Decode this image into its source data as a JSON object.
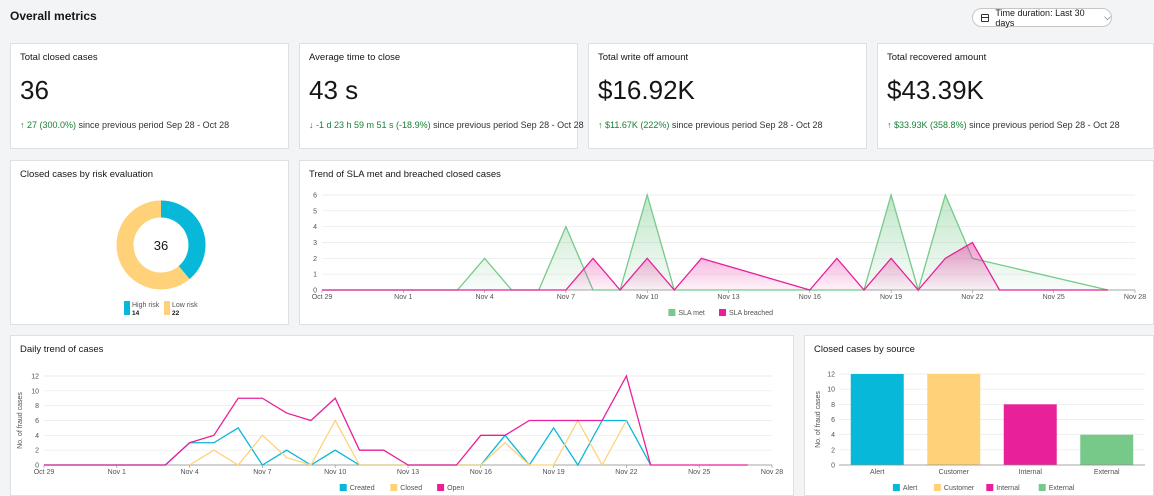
{
  "header": {
    "title": "Overall metrics",
    "time_duration_label": "Time duration: Last 30 days"
  },
  "metrics": [
    {
      "title": "Total closed cases",
      "value": "36",
      "change_arrow": "↑",
      "change": "27 (300.0%)",
      "suffix": " since previous period Sep 28 - Oct 28",
      "direction": "up"
    },
    {
      "title": "Average time to close",
      "value": "43 s",
      "change_arrow": "↓",
      "change": "-1 d 23 h 59 m 51 s (-18.9%)",
      "suffix": " since previous period Sep 28 - Oct 28",
      "direction": "down"
    },
    {
      "title": "Total write off amount",
      "value": "$16.92K",
      "change_arrow": "↑",
      "change": "$11.67K (222%)",
      "suffix": " since previous period Sep 28 - Oct 28",
      "direction": "up"
    },
    {
      "title": "Total recovered amount",
      "value": "$43.39K",
      "change_arrow": "↑",
      "change": "$33.93K (358.8%)",
      "suffix": " since previous period Sep 28 - Oct 28",
      "direction": "up"
    }
  ],
  "colors": {
    "cyan": "#08b8d8",
    "yellow": "#ffd27a",
    "magenta": "#e8209a",
    "green": "#77c98a",
    "positive": "#198038"
  },
  "chart_data": [
    {
      "id": "risk",
      "type": "pie",
      "title": "Closed cases by risk evaluation",
      "center_label": "36",
      "slices": [
        {
          "name": "High risk",
          "value": 14,
          "color": "#08b8d8"
        },
        {
          "name": "Low risk",
          "value": 22,
          "color": "#ffd27a"
        }
      ]
    },
    {
      "id": "sla",
      "type": "area",
      "title": "Trend of SLA met and breached closed cases",
      "ylabel": "No. of fraud cases",
      "ylim": [
        0,
        6
      ],
      "yticks": [
        0,
        1,
        2,
        3,
        4,
        5,
        6
      ],
      "x_tick_labels": [
        "Oct 29",
        "Nov 1",
        "Nov 4",
        "Nov 7",
        "Nov 10",
        "Nov 13",
        "Nov 16",
        "Nov 19",
        "Nov 22",
        "Nov 25",
        "Nov 28"
      ],
      "x_tick_days": [
        0,
        3,
        6,
        9,
        12,
        15,
        18,
        21,
        24,
        27,
        30
      ],
      "xlim": [
        0,
        30
      ],
      "series": [
        {
          "name": "SLA met",
          "color": "#77c98a",
          "x": [
            0,
            5,
            6,
            7,
            8,
            9,
            10,
            11,
            12,
            13,
            20,
            21,
            22,
            23,
            24,
            29
          ],
          "y": [
            0,
            0,
            2,
            0,
            0,
            4,
            0,
            0,
            6,
            0,
            0,
            6,
            0,
            6,
            2,
            0
          ]
        },
        {
          "name": "SLA breached",
          "color": "#e8209a",
          "x": [
            0,
            9,
            10,
            11,
            12,
            13,
            14,
            18,
            19,
            20,
            21,
            22,
            23,
            24,
            25,
            29
          ],
          "y": [
            0,
            0,
            2,
            0,
            2,
            0,
            2,
            0,
            2,
            0,
            2,
            0,
            2,
            3,
            0,
            0
          ]
        }
      ],
      "legend": [
        "SLA met",
        "SLA breached"
      ]
    },
    {
      "id": "daily",
      "type": "line",
      "title": "Daily trend of cases",
      "ylabel": "No. of fraud cases",
      "ylim": [
        0,
        12
      ],
      "yticks": [
        0,
        2,
        4,
        6,
        8,
        10,
        12
      ],
      "x_tick_labels": [
        "Oct 29",
        "Nov 1",
        "Nov 4",
        "Nov 7",
        "Nov 10",
        "Nov 13",
        "Nov 16",
        "Nov 19",
        "Nov 22",
        "Nov 25",
        "Nov 28"
      ],
      "x_tick_days": [
        0,
        3,
        6,
        9,
        12,
        15,
        18,
        21,
        24,
        27,
        30
      ],
      "xlim": [
        0,
        30
      ],
      "series": [
        {
          "name": "Created",
          "color": "#08b8d8",
          "x": [
            0,
            5,
            6,
            7,
            8,
            9,
            10,
            11,
            12,
            13,
            14,
            15,
            18,
            19,
            20,
            21,
            22,
            23,
            24,
            25
          ],
          "y": [
            0,
            0,
            3,
            3,
            5,
            0,
            2,
            0,
            2,
            0,
            0,
            0,
            0,
            4,
            0,
            5,
            0,
            6,
            6,
            0
          ]
        },
        {
          "name": "Closed",
          "color": "#ffd27a",
          "x": [
            6,
            7,
            8,
            9,
            10,
            11,
            12,
            13,
            14,
            18,
            19,
            20,
            21,
            22,
            23,
            24
          ],
          "y": [
            0,
            2,
            0,
            4,
            1,
            0,
            6,
            0,
            0,
            0,
            3,
            0,
            0,
            6,
            0,
            6
          ]
        },
        {
          "name": "Open",
          "color": "#e8209a",
          "x": [
            0,
            5,
            6,
            7,
            8,
            9,
            10,
            11,
            12,
            13,
            14,
            15,
            17,
            18,
            19,
            20,
            21,
            22,
            23,
            24,
            25,
            29
          ],
          "y": [
            0,
            0,
            3,
            4,
            9,
            9,
            7,
            6,
            9,
            2,
            2,
            0,
            0,
            4,
            4,
            6,
            6,
            6,
            6,
            12,
            0,
            0
          ]
        }
      ],
      "legend": [
        "Created",
        "Closed",
        "Open"
      ]
    },
    {
      "id": "source",
      "type": "bar",
      "title": "Closed cases by source",
      "ylabel": "No. of fraud cases",
      "ylim": [
        0,
        12
      ],
      "yticks": [
        0,
        2,
        4,
        6,
        8,
        10,
        12
      ],
      "categories": [
        "Alert",
        "Customer",
        "Internal",
        "External"
      ],
      "values": [
        12,
        12,
        8,
        4
      ],
      "colors": [
        "#08b8d8",
        "#ffd27a",
        "#e8209a",
        "#77c98a"
      ],
      "legend": [
        "Alert",
        "Customer",
        "Internal",
        "External"
      ]
    }
  ]
}
